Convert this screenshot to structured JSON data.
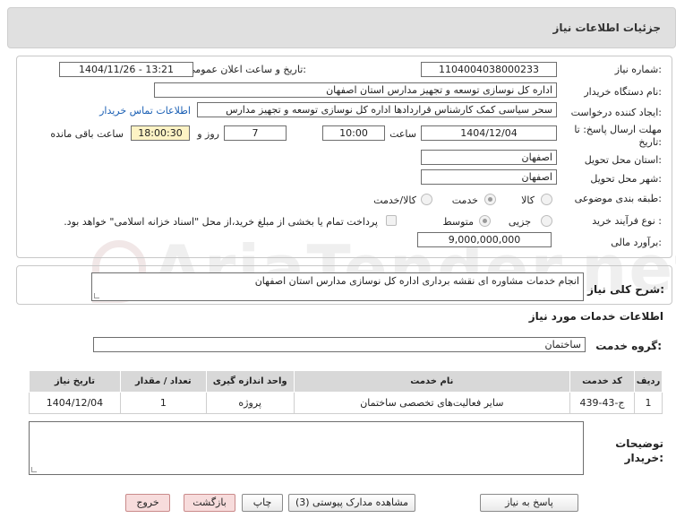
{
  "header": {
    "title": "جزئیات اطلاعات نیاز"
  },
  "form": {
    "need_number_label": "شماره نیاز:",
    "need_number": "1104004038000233",
    "announce_label": "تاریخ و ساعت اعلان عمومی:",
    "announce_value": "1404/11/26 - 13:21",
    "buyer_org_label": "نام دستگاه خریدار:",
    "buyer_org": "اداره کل نوسازی  توسعه و تجهیز مدارس استان اصفهان",
    "creator_label": "ایجاد کننده درخواست:",
    "creator": "سحر سیاسی کمک کارشناس قراردادها اداره کل نوسازی  توسعه و تجهیز مدارس",
    "contact_link": "اطلاعات تماس خریدار",
    "deadline_label": "مهلت ارسال پاسخ: تا تاریخ:",
    "deadline_date": "1404/12/04",
    "time_label": "ساعت",
    "deadline_time": "10:00",
    "days_value": "7",
    "days_label": "روز و",
    "remaining_time": "18:00:30",
    "remaining_label": "ساعت باقی مانده",
    "province_label": "استان محل تحویل:",
    "province": "اصفهان",
    "city_label": "شهر محل تحویل:",
    "city": "اصفهان",
    "category_label": "طبقه بندی موضوعی:",
    "category_options": [
      "کالا",
      "خدمت",
      "کالا/خدمت"
    ],
    "category_selected": "خدمت",
    "process_label": "نوع فرآیند خرید :",
    "process_options": [
      "جزیی",
      "متوسط"
    ],
    "process_selected": "متوسط",
    "payment_note": "پرداخت تمام یا بخشی از مبلغ خرید،از محل \"اسناد خزانه اسلامی\" خواهد بود.",
    "budget_label": "برآورد مالی:",
    "budget": "9,000,000,000"
  },
  "description": {
    "label": "شرح کلی نیاز:",
    "text": "انجام خدمات مشاوره ای نقشه برداری اداره کل نوسازی مدارس استان اصفهان"
  },
  "services": {
    "section_title": "اطلاعات خدمات مورد نیاز",
    "group_label": "گروه خدمت:",
    "group_value": "ساختمان",
    "table": {
      "headers": [
        "ردیف",
        "کد خدمت",
        "نام خدمت",
        "واحد اندازه گیری",
        "تعداد / مقدار",
        "تاریخ نیاز"
      ],
      "rows": [
        [
          "1",
          "ج-43-439",
          "سایر فعالیت‌های تخصصی ساختمان",
          "پروژه",
          "1",
          "1404/12/04"
        ]
      ]
    }
  },
  "buyer_notes": {
    "label": "توضیحات خریدار:",
    "text": ""
  },
  "buttons": {
    "reply": "پاسخ به نیاز",
    "attachments": "مشاهده مدارک پیوستی (3)",
    "print": "چاپ",
    "back": "بازگشت",
    "exit": "خروج"
  },
  "watermark": "AriaTender.net",
  "colors": {
    "link": "#1a5fb4",
    "highlight": "#fdf3c4",
    "header_bg": "#e0e0e0",
    "exit_bg": "#f7dcdc"
  }
}
